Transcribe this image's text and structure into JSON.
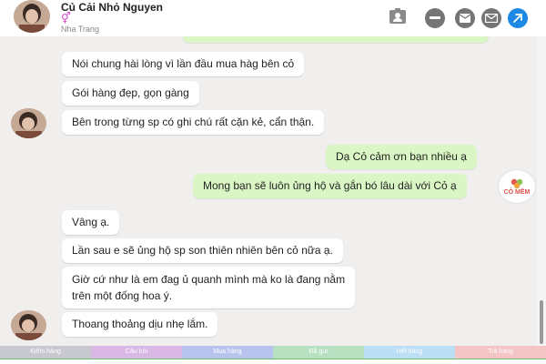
{
  "header": {
    "name": "Củ Cải Nhỏ Nguyen",
    "gender_symbol": "⚥",
    "location": "Nha Trang"
  },
  "messages": [
    {
      "side": "in",
      "text": "Nói chung hài lòng vì lần đầu mua hàg bên cỏ"
    },
    {
      "side": "in",
      "text": "Gói hàng đẹp, gọn gàng"
    },
    {
      "side": "in",
      "text": "Bên trong từng sp có ghi chú rất cặn kẻ, cẩn thận."
    },
    {
      "side": "out",
      "text": "Dạ Cỏ cảm ơn bạn nhiều ạ"
    },
    {
      "side": "out",
      "text": "Mong bạn sẽ luôn ủng hộ và gắn bó lâu dài với Cỏ ạ"
    },
    {
      "side": "in",
      "text": "Vâng ạ."
    },
    {
      "side": "in",
      "text": "Lần sau e sẽ ủng hộ sp son thiên nhiên bên cỏ nữa ạ."
    },
    {
      "side": "in",
      "lines": [
        "Giờ cứ như là em đag ủ quanh mình mà ko là đang nằm",
        "trên một đống hoa ý."
      ]
    },
    {
      "side": "in",
      "text": "Thoang thoảng dịu nhẹ lắm."
    }
  ],
  "brand": {
    "label": "CỎ MỀM"
  },
  "tags": [
    {
      "label": "Kiểm hàng",
      "color": "#c8c8d0"
    },
    {
      "label": "Câu hỏi",
      "color": "#d9b8e6"
    },
    {
      "label": "Mua hàng",
      "color": "#b8c4ee"
    },
    {
      "label": "Đã gửi",
      "color": "#b6e0c0"
    },
    {
      "label": "Hết hàng",
      "color": "#bcdff5"
    },
    {
      "label": "Trả hàng",
      "color": "#f5c4c4"
    }
  ],
  "colors": {
    "incoming_bubble": "#ffffff",
    "outgoing_bubble": "#d9f6c4",
    "chat_background": "#f1eeee",
    "send_button": "#1e88e5"
  }
}
